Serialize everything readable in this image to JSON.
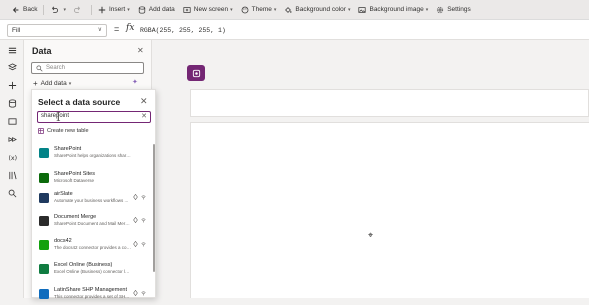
{
  "toolbar": {
    "back": "Back",
    "insert": "Insert",
    "add_data": "Add data",
    "new_screen": "New screen",
    "theme": "Theme",
    "background_color": "Background color",
    "background_image": "Background image",
    "settings": "Settings"
  },
  "formula_bar": {
    "property": "Fill",
    "equals": "=",
    "fx": "fx",
    "formula": "RGBA(255, 255, 255, 1)"
  },
  "data_pane": {
    "title": "Data",
    "search_placeholder": "Search",
    "add_data_label": "Add data"
  },
  "flyout": {
    "title": "Select a data source",
    "search_value": "sharepoint",
    "create_table_label": "Create new table",
    "sources": [
      {
        "name": "SharePoint",
        "description": "SharePoint helps organizations share and c...",
        "icon": "sharepoint-icon",
        "color": "#038387",
        "premium": false
      },
      {
        "name": "SharePoint Sites",
        "description": "Microsoft Dataverse",
        "icon": "sharepoint-sites-icon",
        "color": "#0b6a0b",
        "premium": false
      },
      {
        "name": "airSlate",
        "description": "Automate your business workflows ...",
        "icon": "airslate-icon",
        "color": "#1f3a5f",
        "premium": true
      },
      {
        "name": "Document Merge",
        "description": "SharePoint Document and Mail Merge i...",
        "icon": "document-merge-icon",
        "color": "#2b2b2b",
        "premium": true
      },
      {
        "name": "docs42",
        "description": "The docs42 connector provides a connec...",
        "icon": "docs42-icon",
        "color": "#13a10e",
        "premium": true
      },
      {
        "name": "Excel Online (Business)",
        "description": "Excel Online (Business) connector lets you w...",
        "icon": "excel-icon",
        "color": "#107c41",
        "premium": false
      },
      {
        "name": "LatinShare SHP Management",
        "description": "This connector provides a set of SH...",
        "icon": "latinshare-icon",
        "color": "#0f6cbd",
        "premium": true
      }
    ]
  },
  "colors": {
    "accent": "#742774",
    "toolbar_bg": "#ebe9e8",
    "pane_bg": "#faf9f8"
  }
}
